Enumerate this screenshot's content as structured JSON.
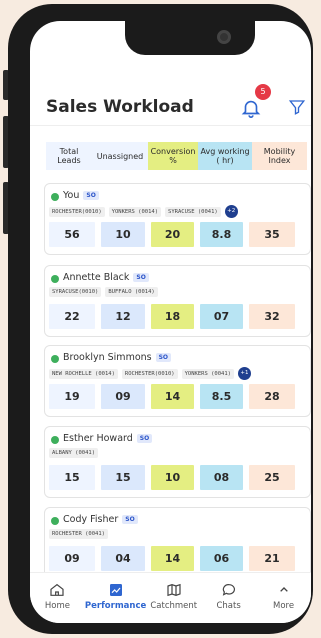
{
  "header": {
    "title": "Sales Workload",
    "notification_count": "5"
  },
  "columns": [
    "Total Leads",
    "Unassigned",
    "Conversion %",
    "Avg working ( hr)",
    "Mobility Index"
  ],
  "column_colors": [
    "#eef4ff",
    "#dbe8fc",
    "#e4ee82",
    "#b8e4f3",
    "#fde7d8"
  ],
  "people": [
    {
      "name": "You",
      "tag": "SO",
      "locations": [
        "ROCHESTER(0010)",
        "YONKERS (0014)",
        "SYRACUSE (0041)"
      ],
      "more": "+2",
      "stats": [
        "56",
        "10",
        "20",
        "8.8",
        "35"
      ]
    },
    {
      "name": "Annette Black",
      "tag": "SO",
      "locations": [
        "SYRACUSE(0010)",
        "BUFFALO (0014)"
      ],
      "more": "",
      "stats": [
        "22",
        "12",
        "18",
        "07",
        "32"
      ]
    },
    {
      "name": "Brooklyn Simmons",
      "tag": "SO",
      "locations": [
        "NEW ROCHELLE (0014)",
        "ROCHESTER(0010)",
        "YONKERS (0041)"
      ],
      "more": "+1",
      "stats": [
        "19",
        "09",
        "14",
        "8.5",
        "28"
      ]
    },
    {
      "name": "Esther Howard",
      "tag": "SO",
      "locations": [
        "ALBANY (0041)"
      ],
      "more": "",
      "stats": [
        "15",
        "15",
        "10",
        "08",
        "25"
      ]
    },
    {
      "name": "Cody Fisher",
      "tag": "SO",
      "locations": [
        "ROCHESTER (0041)"
      ],
      "more": "",
      "stats": [
        "09",
        "04",
        "14",
        "06",
        "21"
      ]
    }
  ],
  "tabs": [
    {
      "label": "Home",
      "icon": "home-icon",
      "active": false
    },
    {
      "label": "Performance",
      "icon": "chart-icon",
      "active": true
    },
    {
      "label": "Catchment",
      "icon": "map-icon",
      "active": false
    },
    {
      "label": "Chats",
      "icon": "chat-icon",
      "active": false
    },
    {
      "label": "More",
      "icon": "chevron-up-icon",
      "active": false
    }
  ]
}
